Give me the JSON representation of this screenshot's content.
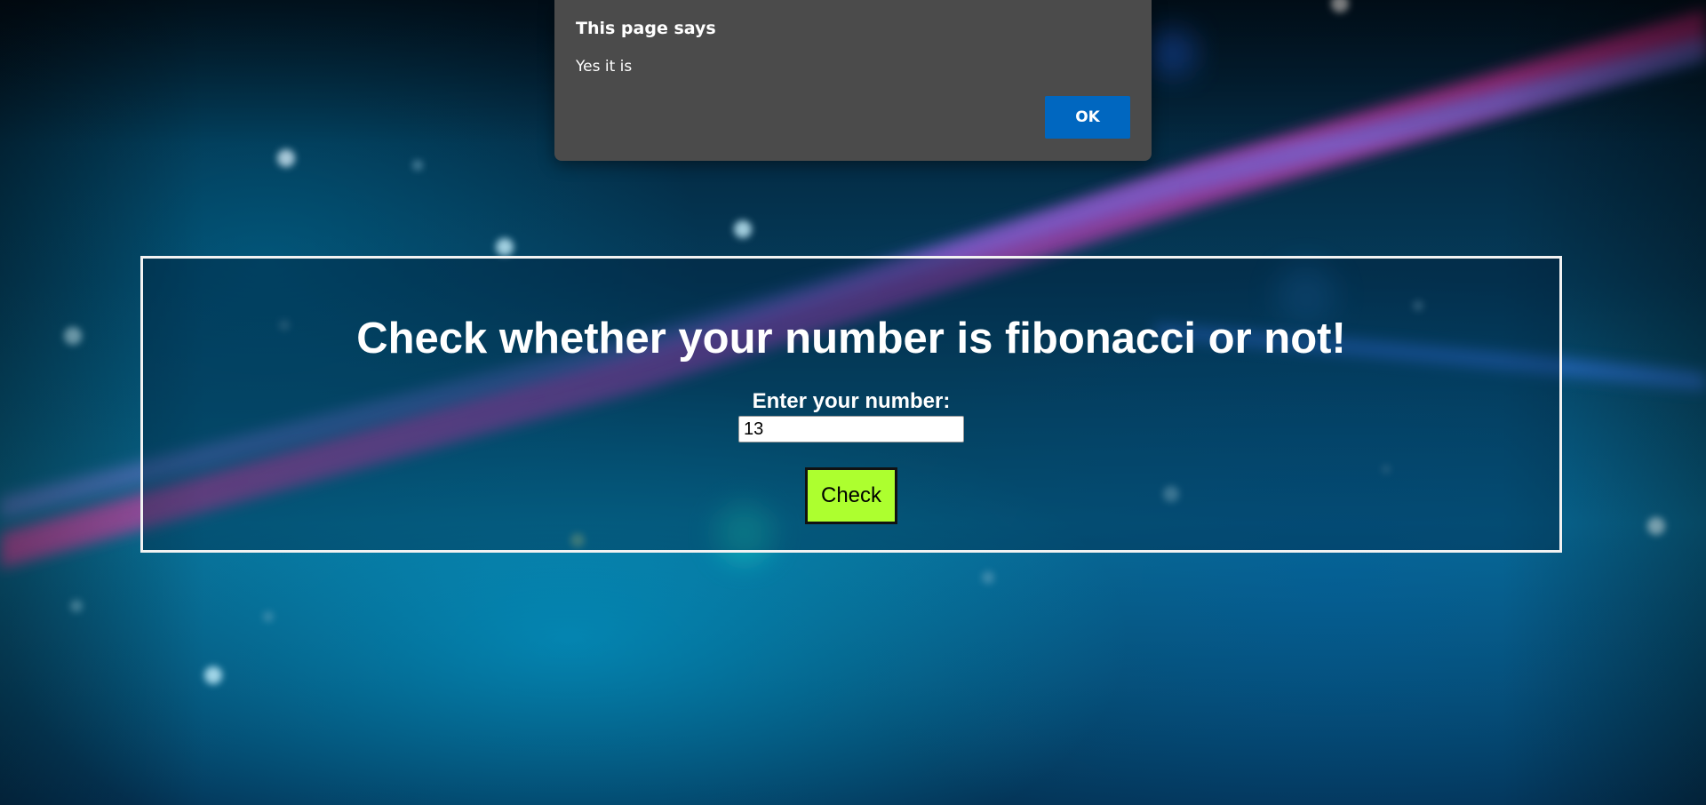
{
  "app": {
    "heading": "Check whether your number is fibonacci or not!",
    "input_label": "Enter your number:",
    "input_value": "13",
    "check_button_label": "Check",
    "button_color": "#adff2f"
  },
  "dialog": {
    "title": "This page says",
    "message": "Yes it is",
    "ok_label": "OK",
    "ok_color": "#0067c0"
  }
}
